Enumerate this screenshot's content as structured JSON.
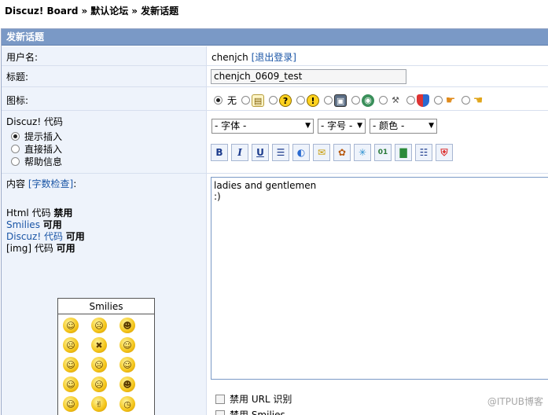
{
  "breadcrumb": {
    "site": "Discuz! Board",
    "sep1": "»",
    "forum": "默认论坛",
    "sep2": "»",
    "page": "发新话题"
  },
  "panel": {
    "title": "发新话题"
  },
  "username": {
    "label": "用户名:",
    "value": "chenjch",
    "logout": "[退出登录]"
  },
  "subject": {
    "label": "标题:",
    "value": "chenjch_0609_test"
  },
  "posticon": {
    "label": "图标:",
    "none_label": "无",
    "icons": [
      "document-icon",
      "question-icon",
      "exclamation-icon",
      "picture-icon",
      "globe-icon",
      "tools-icon",
      "shield-icon",
      "thumb-up-icon",
      "thumb-down-icon"
    ]
  },
  "code": {
    "label": "Discuz! 代码",
    "options": [
      "提示插入",
      "直接插入",
      "帮助信息"
    ],
    "selected": 0,
    "font_select": "- 字体 -",
    "size_select": "- 字号 -",
    "color_select": "- 颜色 -"
  },
  "toolbar": {
    "bold": "B",
    "italic": "I",
    "underline": "U",
    "buttons": [
      "align-center-icon",
      "link-icon",
      "email-icon",
      "image-icon",
      "flash-icon",
      "code-icon",
      "quote-icon",
      "list-icon",
      "hide-icon"
    ]
  },
  "content": {
    "label": "内容",
    "check": "[字数检查]",
    "colon": ":",
    "html_label": "Html 代码",
    "html_state": "禁用",
    "smilies_label": "Smilies",
    "smilies_state": "可用",
    "discuz_label": "Discuz! 代码",
    "discuz_state": "可用",
    "img_label": "[img] 代码",
    "img_state": "可用",
    "message": "ladies and gentlemen\n:)"
  },
  "smilies": {
    "title": "Smilies",
    "faces": [
      "☺",
      "☹",
      "☻",
      "☹",
      "✖",
      "☺",
      "☺",
      "☹",
      "☺",
      "☺",
      "☹",
      "☻",
      "☺",
      "✌",
      "◷",
      "❤",
      "✋",
      "☎"
    ]
  },
  "options": {
    "disable_url": "禁用 URL 识别",
    "disable_smilies": "禁用 Smilies"
  },
  "watermark": "@ITPUB博客",
  "colors": {
    "header": "#7a99c6",
    "label_bg": "#eef3fb",
    "link": "#1a55a6"
  }
}
